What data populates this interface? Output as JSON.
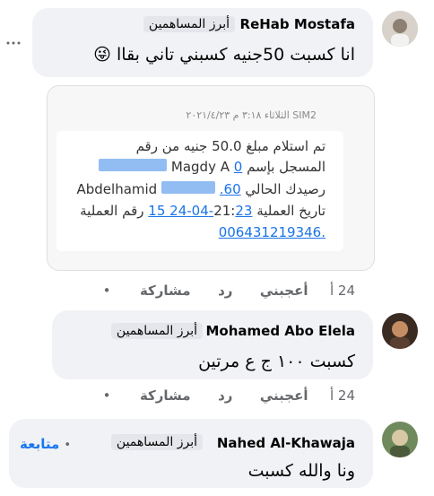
{
  "comments": [
    {
      "author": "ReHab Mostafa",
      "badge": "أبرز المساهمين",
      "text": "انا كسبت 50جنيه كسبني تاني بقاا",
      "emoji": "😜",
      "more_icon": "more-dots-icon",
      "attachment": {
        "header": "SIM2   الثلاثاء ٣:١٨ م  ٢٠٢١/٤/٢٣",
        "line1": "تم استلام مبلغ 50.0 جنيه من رقم",
        "line2_number": "0",
        "line2_text": "المسجل بإسم Magdy A",
        "line3_name": "Abdelhamid",
        "line3_balance": "60.",
        "line3_text": "رصيدك الحالي",
        "line4_label": "تاريخ العملية",
        "line4_value": "21:",
        "line4_link": "23-04-24 15",
        "line4_tail": "رقم العملية",
        "line5_link": ".006431219346"
      },
      "time": "24 أ",
      "like_label": "أعجبني",
      "reply_label": "رد",
      "share_label": "مشاركة",
      "dot": "•"
    },
    {
      "author": "Mohamed Abo Elela",
      "badge": "أبرز المساهمين",
      "text": "كسبت ١٠٠ ج ع مرتين",
      "time": "24 أ",
      "like_label": "أعجبني",
      "reply_label": "رد",
      "share_label": "مشاركة",
      "dot": "•"
    },
    {
      "author": "Nahed Al-Khawaja",
      "badge": "أبرز المساهمين",
      "follow_label": "متابعة",
      "follow_dot": "•",
      "text": "ونا والله كسبت"
    }
  ]
}
